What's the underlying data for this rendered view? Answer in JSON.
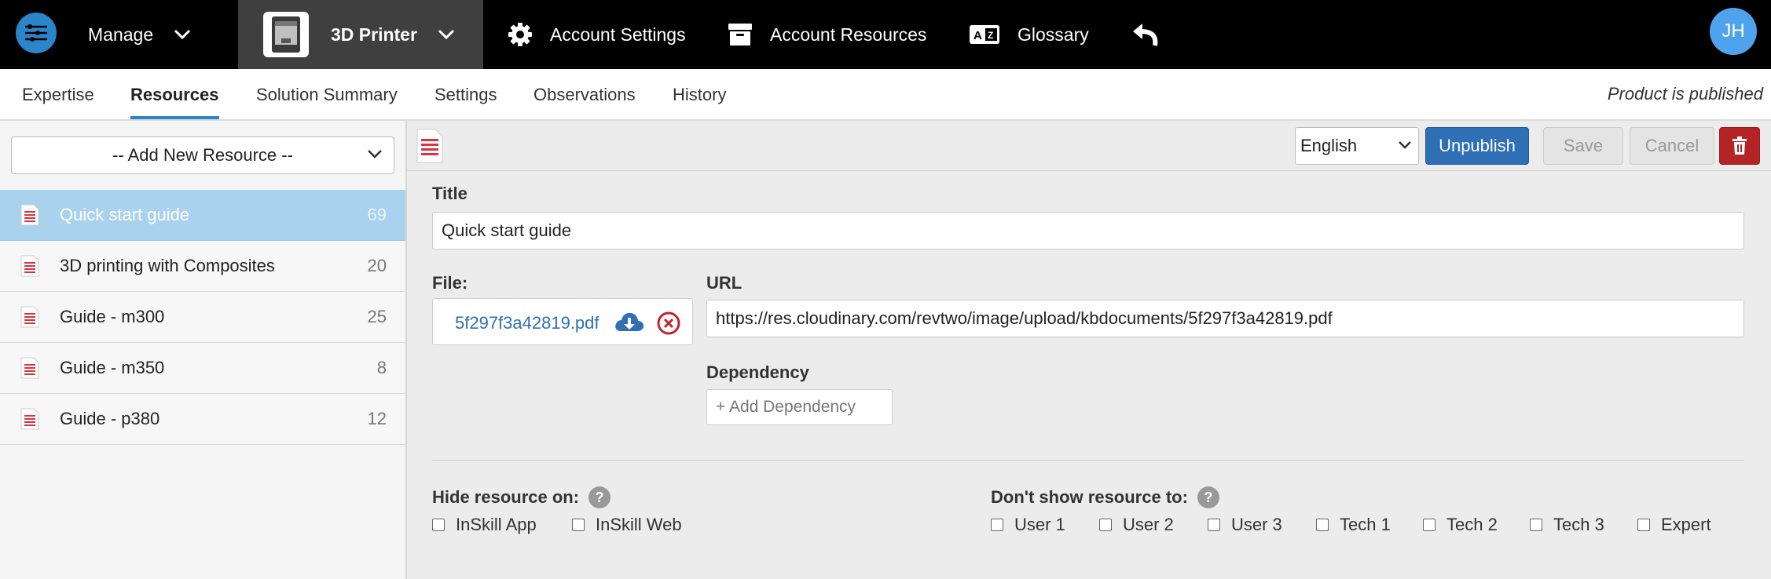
{
  "topbar": {
    "manage_label": "Manage",
    "product_label": "3D Printer",
    "account_settings_label": "Account Settings",
    "account_resources_label": "Account Resources",
    "glossary_label": "Glossary",
    "avatar_initials": "JH"
  },
  "tabs": [
    {
      "label": "Expertise",
      "active": false
    },
    {
      "label": "Resources",
      "active": true
    },
    {
      "label": "Solution Summary",
      "active": false
    },
    {
      "label": "Settings",
      "active": false
    },
    {
      "label": "Observations",
      "active": false
    },
    {
      "label": "History",
      "active": false
    }
  ],
  "status": {
    "published_text": "Product is published"
  },
  "sidebar": {
    "add_resource_label": "-- Add New Resource --",
    "items": [
      {
        "name": "Quick start guide",
        "count": "69",
        "selected": true
      },
      {
        "name": "3D printing with Composites",
        "count": "20",
        "selected": false
      },
      {
        "name": "Guide - m300",
        "count": "25",
        "selected": false
      },
      {
        "name": "Guide - m350",
        "count": "8",
        "selected": false
      },
      {
        "name": "Guide - p380",
        "count": "12",
        "selected": false
      }
    ]
  },
  "toolbar": {
    "language": "English",
    "unpublish_label": "Unpublish",
    "save_label": "Save",
    "cancel_label": "Cancel"
  },
  "form": {
    "title_label": "Title",
    "title_value": "Quick start guide",
    "file_label": "File:",
    "file_name": "5f297f3a42819.pdf",
    "url_label": "URL",
    "url_value": "https://res.cloudinary.com/revtwo/image/upload/kbdocuments/5f297f3a42819.pdf",
    "dependency_label": "Dependency",
    "dependency_placeholder": "+ Add Dependency",
    "hide_label": "Hide resource on:",
    "hide_options": [
      "InSkill App",
      "InSkill Web"
    ],
    "show_label": "Don't show resource to:",
    "show_options": [
      "User 1",
      "User 2",
      "User 3",
      "Tech 1",
      "Tech 2",
      "Tech 3",
      "Expert"
    ],
    "help_glyph": "?"
  },
  "colors": {
    "accent": "#2b85c8",
    "primary_button": "#2e6fb6",
    "danger": "#b52424",
    "selected_row": "#a9d2ef",
    "doc_icon": "#d9343f"
  },
  "icons": [
    "app-logo-icon",
    "chevron-down-icon",
    "printer-icon",
    "gear-icon",
    "archive-box-icon",
    "glossary-icon",
    "undo-arrow-icon",
    "document-icon",
    "cloud-download-icon",
    "remove-circle-icon",
    "trash-icon",
    "help-icon"
  ]
}
